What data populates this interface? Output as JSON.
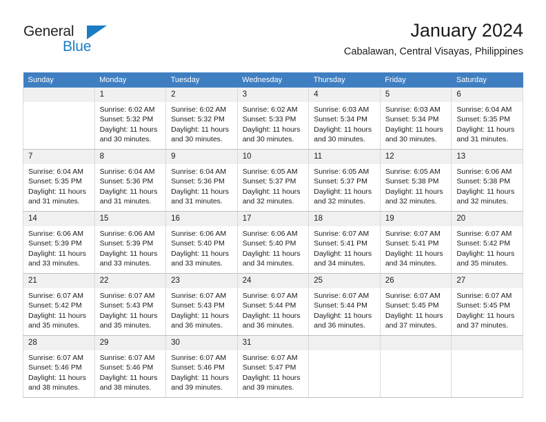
{
  "brand": {
    "name_part1": "General",
    "name_part2": "Blue",
    "triangle_icon": "triangle-icon",
    "accent_color": "#1a7dc4"
  },
  "header": {
    "title": "January 2024",
    "subtitle": "Cabalawan, Central Visayas, Philippines"
  },
  "calendar": {
    "header_color": "#3f7fc1",
    "weekday_headers": [
      "Sunday",
      "Monday",
      "Tuesday",
      "Wednesday",
      "Thursday",
      "Friday",
      "Saturday"
    ],
    "labels": {
      "sunrise": "Sunrise:",
      "sunset": "Sunset:",
      "daylight": "Daylight:"
    },
    "weeks": [
      [
        {
          "day": "",
          "blank": true
        },
        {
          "day": "1",
          "sunrise": "Sunrise: 6:02 AM",
          "sunset": "Sunset: 5:32 PM",
          "daylight": "Daylight: 11 hours and 30 minutes."
        },
        {
          "day": "2",
          "sunrise": "Sunrise: 6:02 AM",
          "sunset": "Sunset: 5:32 PM",
          "daylight": "Daylight: 11 hours and 30 minutes."
        },
        {
          "day": "3",
          "sunrise": "Sunrise: 6:02 AM",
          "sunset": "Sunset: 5:33 PM",
          "daylight": "Daylight: 11 hours and 30 minutes."
        },
        {
          "day": "4",
          "sunrise": "Sunrise: 6:03 AM",
          "sunset": "Sunset: 5:34 PM",
          "daylight": "Daylight: 11 hours and 30 minutes."
        },
        {
          "day": "5",
          "sunrise": "Sunrise: 6:03 AM",
          "sunset": "Sunset: 5:34 PM",
          "daylight": "Daylight: 11 hours and 30 minutes."
        },
        {
          "day": "6",
          "sunrise": "Sunrise: 6:04 AM",
          "sunset": "Sunset: 5:35 PM",
          "daylight": "Daylight: 11 hours and 31 minutes."
        }
      ],
      [
        {
          "day": "7",
          "sunrise": "Sunrise: 6:04 AM",
          "sunset": "Sunset: 5:35 PM",
          "daylight": "Daylight: 11 hours and 31 minutes."
        },
        {
          "day": "8",
          "sunrise": "Sunrise: 6:04 AM",
          "sunset": "Sunset: 5:36 PM",
          "daylight": "Daylight: 11 hours and 31 minutes."
        },
        {
          "day": "9",
          "sunrise": "Sunrise: 6:04 AM",
          "sunset": "Sunset: 5:36 PM",
          "daylight": "Daylight: 11 hours and 31 minutes."
        },
        {
          "day": "10",
          "sunrise": "Sunrise: 6:05 AM",
          "sunset": "Sunset: 5:37 PM",
          "daylight": "Daylight: 11 hours and 32 minutes."
        },
        {
          "day": "11",
          "sunrise": "Sunrise: 6:05 AM",
          "sunset": "Sunset: 5:37 PM",
          "daylight": "Daylight: 11 hours and 32 minutes."
        },
        {
          "day": "12",
          "sunrise": "Sunrise: 6:05 AM",
          "sunset": "Sunset: 5:38 PM",
          "daylight": "Daylight: 11 hours and 32 minutes."
        },
        {
          "day": "13",
          "sunrise": "Sunrise: 6:06 AM",
          "sunset": "Sunset: 5:38 PM",
          "daylight": "Daylight: 11 hours and 32 minutes."
        }
      ],
      [
        {
          "day": "14",
          "sunrise": "Sunrise: 6:06 AM",
          "sunset": "Sunset: 5:39 PM",
          "daylight": "Daylight: 11 hours and 33 minutes."
        },
        {
          "day": "15",
          "sunrise": "Sunrise: 6:06 AM",
          "sunset": "Sunset: 5:39 PM",
          "daylight": "Daylight: 11 hours and 33 minutes."
        },
        {
          "day": "16",
          "sunrise": "Sunrise: 6:06 AM",
          "sunset": "Sunset: 5:40 PM",
          "daylight": "Daylight: 11 hours and 33 minutes."
        },
        {
          "day": "17",
          "sunrise": "Sunrise: 6:06 AM",
          "sunset": "Sunset: 5:40 PM",
          "daylight": "Daylight: 11 hours and 34 minutes."
        },
        {
          "day": "18",
          "sunrise": "Sunrise: 6:07 AM",
          "sunset": "Sunset: 5:41 PM",
          "daylight": "Daylight: 11 hours and 34 minutes."
        },
        {
          "day": "19",
          "sunrise": "Sunrise: 6:07 AM",
          "sunset": "Sunset: 5:41 PM",
          "daylight": "Daylight: 11 hours and 34 minutes."
        },
        {
          "day": "20",
          "sunrise": "Sunrise: 6:07 AM",
          "sunset": "Sunset: 5:42 PM",
          "daylight": "Daylight: 11 hours and 35 minutes."
        }
      ],
      [
        {
          "day": "21",
          "sunrise": "Sunrise: 6:07 AM",
          "sunset": "Sunset: 5:42 PM",
          "daylight": "Daylight: 11 hours and 35 minutes."
        },
        {
          "day": "22",
          "sunrise": "Sunrise: 6:07 AM",
          "sunset": "Sunset: 5:43 PM",
          "daylight": "Daylight: 11 hours and 35 minutes."
        },
        {
          "day": "23",
          "sunrise": "Sunrise: 6:07 AM",
          "sunset": "Sunset: 5:43 PM",
          "daylight": "Daylight: 11 hours and 36 minutes."
        },
        {
          "day": "24",
          "sunrise": "Sunrise: 6:07 AM",
          "sunset": "Sunset: 5:44 PM",
          "daylight": "Daylight: 11 hours and 36 minutes."
        },
        {
          "day": "25",
          "sunrise": "Sunrise: 6:07 AM",
          "sunset": "Sunset: 5:44 PM",
          "daylight": "Daylight: 11 hours and 36 minutes."
        },
        {
          "day": "26",
          "sunrise": "Sunrise: 6:07 AM",
          "sunset": "Sunset: 5:45 PM",
          "daylight": "Daylight: 11 hours and 37 minutes."
        },
        {
          "day": "27",
          "sunrise": "Sunrise: 6:07 AM",
          "sunset": "Sunset: 5:45 PM",
          "daylight": "Daylight: 11 hours and 37 minutes."
        }
      ],
      [
        {
          "day": "28",
          "sunrise": "Sunrise: 6:07 AM",
          "sunset": "Sunset: 5:46 PM",
          "daylight": "Daylight: 11 hours and 38 minutes."
        },
        {
          "day": "29",
          "sunrise": "Sunrise: 6:07 AM",
          "sunset": "Sunset: 5:46 PM",
          "daylight": "Daylight: 11 hours and 38 minutes."
        },
        {
          "day": "30",
          "sunrise": "Sunrise: 6:07 AM",
          "sunset": "Sunset: 5:46 PM",
          "daylight": "Daylight: 11 hours and 39 minutes."
        },
        {
          "day": "31",
          "sunrise": "Sunrise: 6:07 AM",
          "sunset": "Sunset: 5:47 PM",
          "daylight": "Daylight: 11 hours and 39 minutes."
        },
        {
          "day": "",
          "blank": true
        },
        {
          "day": "",
          "blank": true
        },
        {
          "day": "",
          "blank": true
        }
      ]
    ]
  }
}
